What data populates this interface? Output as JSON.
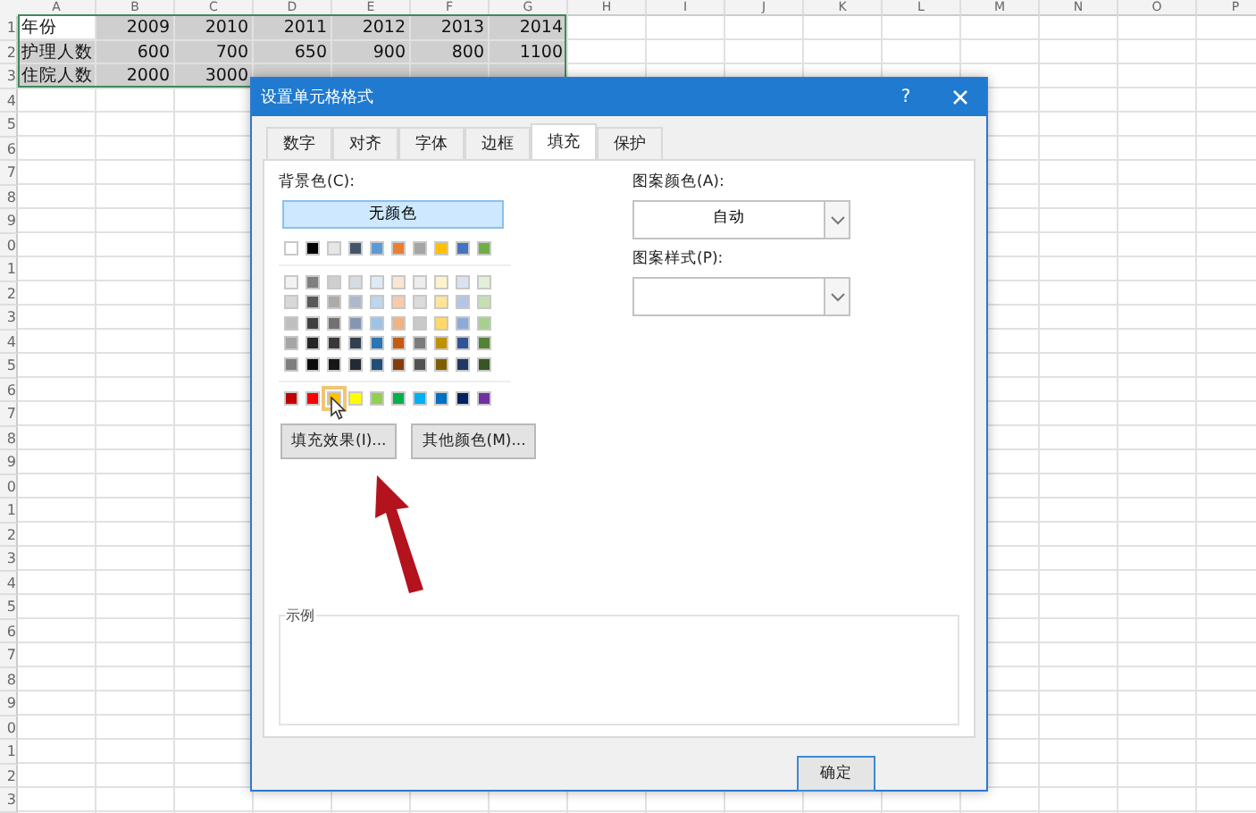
{
  "spreadsheet": {
    "column_headers": [
      "A",
      "B",
      "C",
      "D",
      "E",
      "F",
      "G",
      "H",
      "I",
      "J",
      "K",
      "L",
      "M",
      "N",
      "O",
      "P"
    ],
    "row_numbers": [
      "1",
      "2",
      "3",
      "4",
      "5",
      "6",
      "7",
      "8",
      "9",
      "0",
      "1",
      "2",
      "3",
      "4",
      "5",
      "6",
      "7",
      "8",
      "9",
      "0",
      "1",
      "2",
      "3",
      "4",
      "5",
      "6",
      "7",
      "8",
      "9",
      "0",
      "1",
      "2",
      "3"
    ],
    "rows": [
      {
        "cells": [
          {
            "text": "年份",
            "filled": false
          },
          {
            "text": "2009",
            "filled": true
          },
          {
            "text": "2010",
            "filled": true
          },
          {
            "text": "2011",
            "filled": true
          },
          {
            "text": "2012",
            "filled": true
          },
          {
            "text": "2013",
            "filled": true
          },
          {
            "text": "2014",
            "filled": true
          }
        ]
      },
      {
        "cells": [
          {
            "text": "护理人数",
            "filled": true
          },
          {
            "text": "600",
            "filled": true
          },
          {
            "text": "700",
            "filled": true
          },
          {
            "text": "650",
            "filled": true
          },
          {
            "text": "900",
            "filled": true
          },
          {
            "text": "800",
            "filled": true
          },
          {
            "text": "1100",
            "filled": true
          }
        ]
      },
      {
        "cells": [
          {
            "text": "住院人数",
            "filled": true
          },
          {
            "text": "2000",
            "filled": true
          },
          {
            "text": "3000",
            "filled": true
          },
          {
            "filled": true
          },
          {
            "filled": true
          },
          {
            "filled": true
          },
          {
            "filled": true
          }
        ]
      }
    ]
  },
  "dialog": {
    "title": "设置单元格格式",
    "help": "?",
    "tabs": [
      {
        "label": "数字",
        "selected": false
      },
      {
        "label": "对齐",
        "selected": false
      },
      {
        "label": "字体",
        "selected": false
      },
      {
        "label": "边框",
        "selected": false
      },
      {
        "label": "填充",
        "selected": true
      },
      {
        "label": "保护",
        "selected": false
      }
    ],
    "fill": {
      "background_label": "背景色(C):",
      "no_color_button": "无颜色",
      "theme_colors": [
        {
          "color": "#ffffff"
        },
        {
          "color": "#000000"
        },
        {
          "color": "#e7e6e6"
        },
        {
          "color": "#44546a"
        },
        {
          "color": "#5b9bd5"
        },
        {
          "color": "#ed7d31"
        },
        {
          "color": "#a5a5a5"
        },
        {
          "color": "#ffc000"
        },
        {
          "color": "#4472c4"
        },
        {
          "color": "#70ad47"
        }
      ],
      "tints": [
        {
          "swatches": [
            {
              "color": "#f2f2f2"
            },
            {
              "color": "#7f7f7f"
            },
            {
              "color": "#d0cece"
            },
            {
              "color": "#d6dce4"
            },
            {
              "color": "#deebf6"
            },
            {
              "color": "#fbe5d5"
            },
            {
              "color": "#ededed"
            },
            {
              "color": "#fff2cc"
            },
            {
              "color": "#dae3f3"
            },
            {
              "color": "#e2efd9"
            }
          ]
        },
        {
          "swatches": [
            {
              "color": "#d8d8d8"
            },
            {
              "color": "#595959"
            },
            {
              "color": "#aeaaaa"
            },
            {
              "color": "#adb9ca"
            },
            {
              "color": "#bdd7ee"
            },
            {
              "color": "#f7cbac"
            },
            {
              "color": "#dbdbdb"
            },
            {
              "color": "#fee599"
            },
            {
              "color": "#b4c6e7"
            },
            {
              "color": "#c5e0b3"
            }
          ]
        },
        {
          "swatches": [
            {
              "color": "#bfbfbf"
            },
            {
              "color": "#3f3f3f"
            },
            {
              "color": "#757070"
            },
            {
              "color": "#8496b0"
            },
            {
              "color": "#9dc3e6"
            },
            {
              "color": "#f4b183"
            },
            {
              "color": "#c9c9c9"
            },
            {
              "color": "#ffd965"
            },
            {
              "color": "#8eaadb"
            },
            {
              "color": "#a8d08d"
            }
          ]
        },
        {
          "swatches": [
            {
              "color": "#a5a5a5"
            },
            {
              "color": "#262626"
            },
            {
              "color": "#3a3838"
            },
            {
              "color": "#323f4f"
            },
            {
              "color": "#2e75b5"
            },
            {
              "color": "#c55a11"
            },
            {
              "color": "#7b7b7b"
            },
            {
              "color": "#bf9000"
            },
            {
              "color": "#2f5496"
            },
            {
              "color": "#538135"
            }
          ]
        },
        {
          "swatches": [
            {
              "color": "#7f7f7f"
            },
            {
              "color": "#0c0c0c"
            },
            {
              "color": "#171616"
            },
            {
              "color": "#222a35"
            },
            {
              "color": "#1e4e79"
            },
            {
              "color": "#843c0b"
            },
            {
              "color": "#525252"
            },
            {
              "color": "#7f6000"
            },
            {
              "color": "#1f3864"
            },
            {
              "color": "#375623"
            }
          ]
        }
      ],
      "standard_colors": [
        {
          "color": "#c00000",
          "highlighted": false
        },
        {
          "color": "#ff0000",
          "highlighted": false
        },
        {
          "color": "#ffc000",
          "highlighted": true
        },
        {
          "color": "#ffff00",
          "highlighted": false
        },
        {
          "color": "#92d050",
          "highlighted": false
        },
        {
          "color": "#00b050",
          "highlighted": false
        },
        {
          "color": "#00b0f0",
          "highlighted": false
        },
        {
          "color": "#0070c0",
          "highlighted": false
        },
        {
          "color": "#002060",
          "highlighted": false
        },
        {
          "color": "#7030a0",
          "highlighted": false
        }
      ],
      "fill_effects_button": "填充效果(I)...",
      "more_colors_button": "其他颜色(M)...",
      "pattern_color": {
        "label": "图案颜色(A):",
        "value": "自动"
      },
      "pattern_style": {
        "label": "图案样式(P):"
      },
      "sample_label": "示例"
    },
    "buttons": [
      "确定"
    ]
  }
}
